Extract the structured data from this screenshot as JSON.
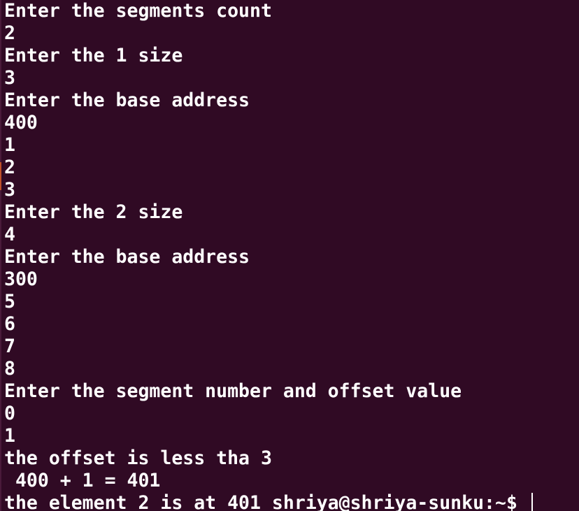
{
  "terminal": {
    "lines": [
      "Enter the segments count",
      "2",
      "Enter the 1 size",
      "3",
      "Enter the base address",
      "400",
      "1",
      "2",
      "3",
      "Enter the 2 size",
      "4",
      "Enter the base address",
      "300",
      "5",
      "6",
      "7",
      "8",
      "Enter the segment number and offset value",
      "0",
      "1",
      "the offset is less tha 3",
      " 400 + 1 = 401"
    ],
    "last_line_output": "the element 2 is at 401 ",
    "prompt": "shriya@shriya-sunku:~$ "
  },
  "colors": {
    "background": "#300a24",
    "text": "#ffffff"
  }
}
